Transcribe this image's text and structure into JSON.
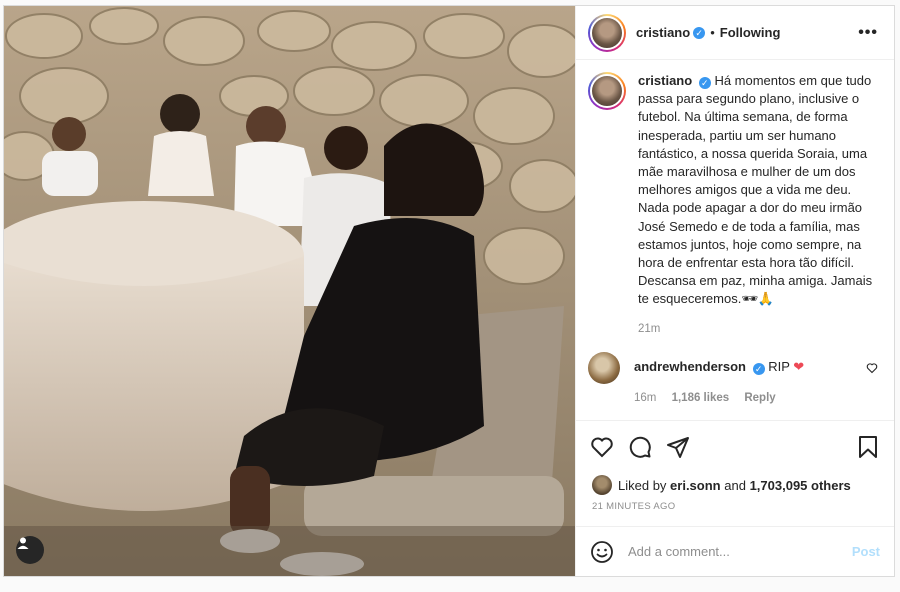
{
  "post": {
    "photo_alt": "",
    "user_tag_icon": "user-icon"
  },
  "header": {
    "username": "cristiano",
    "separator": "•",
    "follow_state": "Following",
    "more_icon": "ellipsis-icon"
  },
  "caption": {
    "username": "cristiano",
    "text": "Há momentos em que tudo passa para segundo plano, inclusive o futebol. Na última semana, de forma inesperada, partiu um ser humano fantástico, a nossa querida Soraia, uma mãe maravilhosa e mulher de um dos melhores amigos que a vida me deu. Nada pode apagar a dor do meu irmão José Semedo e de toda a família, mas estamos juntos, hoje como sempre, na hora de enfrentar esta hora tão difícil. Descansa em paz, minha amiga. Jamais te esqueceremos.",
    "emoji": "🕶🙏",
    "time": "21m"
  },
  "reply": {
    "username": "andrewhenderson",
    "text": "RIP",
    "emoji": "❤",
    "time": "16m",
    "likes": "1,186 likes",
    "reply_label": "Reply"
  },
  "actions": {
    "like_icon": "heart-icon",
    "comment_icon": "comment-icon",
    "share_icon": "share-icon",
    "save_icon": "bookmark-icon"
  },
  "likes": {
    "prefix": "Liked by",
    "user": "eri.sonn",
    "middle": "and",
    "count": "1,703,095 others"
  },
  "timestamp": "21 MINUTES AGO",
  "composer": {
    "placeholder": "Add a comment...",
    "post_label": "Post",
    "emoji_icon": "smiley-icon"
  },
  "colors": {
    "verified": "#3897f0",
    "heart": "#ed4956",
    "post_disabled": "#b2dffc",
    "muted": "#8e8e8e"
  }
}
